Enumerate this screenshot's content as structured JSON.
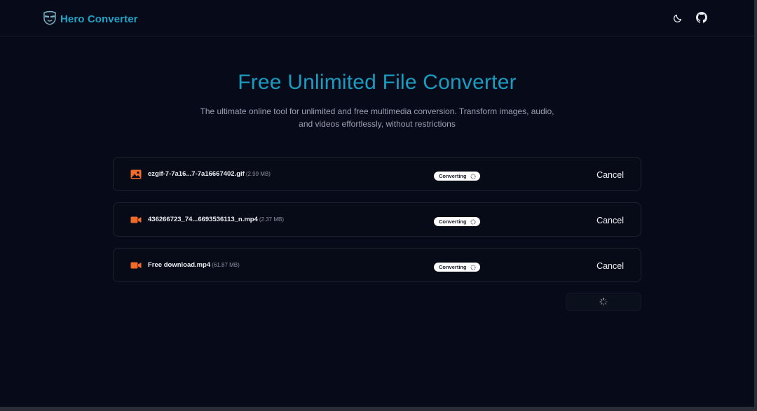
{
  "header": {
    "brand_name": "Hero Converter",
    "icons": [
      "mask-logo-icon",
      "moon-icon",
      "github-icon"
    ]
  },
  "hero": {
    "title": "Free Unlimited File Converter",
    "subtitle": "The ultimate online tool for unlimited and free multimedia conversion. Transform images, audio, and videos effortlessly, without restrictions"
  },
  "files": [
    {
      "icon": "image-icon",
      "name": "ezgif-7-7a16...7-7a16667402.gif",
      "size": "(2.99 MB)",
      "status": "Converting",
      "cancel_label": "Cancel"
    },
    {
      "icon": "video-icon",
      "name": "436266723_74...6693536113_n.mp4",
      "size": "(2.37 MB)",
      "status": "Converting",
      "cancel_label": "Cancel"
    },
    {
      "icon": "video-icon",
      "name": "Free download.mp4",
      "size": "(61.87 MB)",
      "status": "Converting",
      "cancel_label": "Cancel"
    }
  ],
  "colors": {
    "background": "#060a19",
    "brand": "#1fa3c7",
    "title": "#1a9cc0",
    "file_icon": "#f06a2a",
    "badge_bg": "#ffffff"
  }
}
